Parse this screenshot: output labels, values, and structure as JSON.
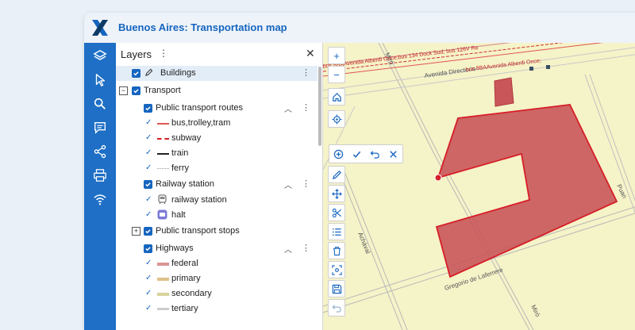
{
  "app": {
    "title": "Buenos Aires: Transportation map",
    "logo_icon": "x-logo-icon",
    "accent_color": "#1565c0",
    "toolbar_color": "#1e6fc5"
  },
  "toolbar": {
    "items": [
      {
        "icon": "layers-icon"
      },
      {
        "icon": "pointer-icon"
      },
      {
        "icon": "search-icon"
      },
      {
        "icon": "comment-icon"
      },
      {
        "icon": "share-icon"
      },
      {
        "icon": "print-icon"
      },
      {
        "icon": "wifi-icon"
      }
    ]
  },
  "layers_panel": {
    "title": "Layers",
    "menu_glyph": "⋮",
    "close_glyph": "✕",
    "rows": [
      {
        "label": "Buildings"
      },
      {
        "label": "Transport"
      },
      {
        "label": "Public transport routes"
      },
      {
        "label": "bus,trolley,tram",
        "color": "#e05555"
      },
      {
        "label": "subway",
        "color": "#d62020"
      },
      {
        "label": "train",
        "color": "#222222"
      },
      {
        "label": "ferry",
        "color": "#aaaaaa"
      },
      {
        "label": "Railway station"
      },
      {
        "label": "railway station"
      },
      {
        "label": "halt"
      },
      {
        "label": "Public transport stops"
      },
      {
        "label": "Highways"
      },
      {
        "label": "federal",
        "color": "#d99595"
      },
      {
        "label": "primary",
        "color": "#e0c08a"
      },
      {
        "label": "secondary",
        "color": "#d8d49a"
      },
      {
        "label": "tertiary",
        "color": "#cccccc"
      }
    ]
  },
  "map": {
    "background_color": "#f5f3c8",
    "polygon_color": "#c9575a",
    "streets": [
      {
        "label": "Miró"
      },
      {
        "label": "Avenida Directorio"
      },
      {
        "label": "bus 8BAAvenida Alberdi Once;bus 134 Dock Sud; bus 126V Re"
      },
      {
        "label": "bus 8BAAvenida Alberdi Once;"
      },
      {
        "label": "Achával"
      },
      {
        "label": "Gregorio de Laferrere"
      },
      {
        "label": "Miró"
      },
      {
        "label": "Puan"
      }
    ],
    "zoom_controls": {
      "in": "+",
      "out": "−"
    },
    "edit_toolbar": [
      "add-vertex-icon",
      "confirm-icon",
      "undo-icon",
      "cancel-icon"
    ]
  }
}
